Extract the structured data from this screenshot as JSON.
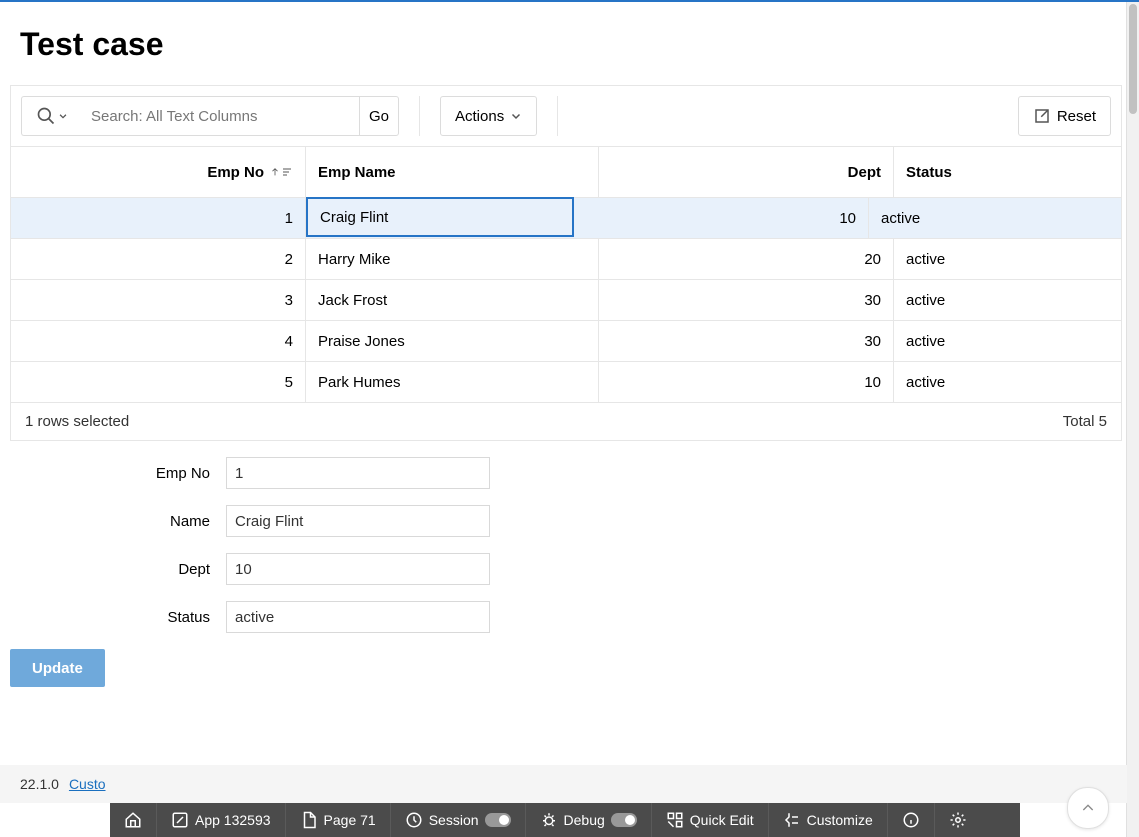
{
  "page_title": "Test case",
  "toolbar": {
    "search_placeholder": "Search: All Text Columns",
    "go_label": "Go",
    "actions_label": "Actions",
    "reset_label": "Reset"
  },
  "grid": {
    "headers": {
      "emp_no": "Emp No",
      "emp_name": "Emp Name",
      "dept": "Dept",
      "status": "Status"
    },
    "rows": [
      {
        "emp_no": "1",
        "name": "Craig Flint",
        "dept": "10",
        "status": "active",
        "selected": true
      },
      {
        "emp_no": "2",
        "name": "Harry Mike",
        "dept": "20",
        "status": "active",
        "selected": false
      },
      {
        "emp_no": "3",
        "name": "Jack Frost",
        "dept": "30",
        "status": "active",
        "selected": false
      },
      {
        "emp_no": "4",
        "name": "Praise Jones",
        "dept": "30",
        "status": "active",
        "selected": false
      },
      {
        "emp_no": "5",
        "name": "Park Humes",
        "dept": "10",
        "status": "active",
        "selected": false
      }
    ],
    "footer_selected": "1 rows selected",
    "footer_total": "Total 5"
  },
  "form": {
    "emp_no_label": "Emp No",
    "emp_no_value": "1",
    "name_label": "Name",
    "name_value": "Craig Flint",
    "dept_label": "Dept",
    "dept_value": "10",
    "status_label": "Status",
    "status_value": "active",
    "update_label": "Update"
  },
  "footer": {
    "version": "22.1.0",
    "customize": "Custo"
  },
  "devbar": {
    "app": "App 132593",
    "page": "Page 71",
    "session": "Session",
    "debug": "Debug",
    "quick_edit": "Quick Edit",
    "customize": "Customize"
  }
}
